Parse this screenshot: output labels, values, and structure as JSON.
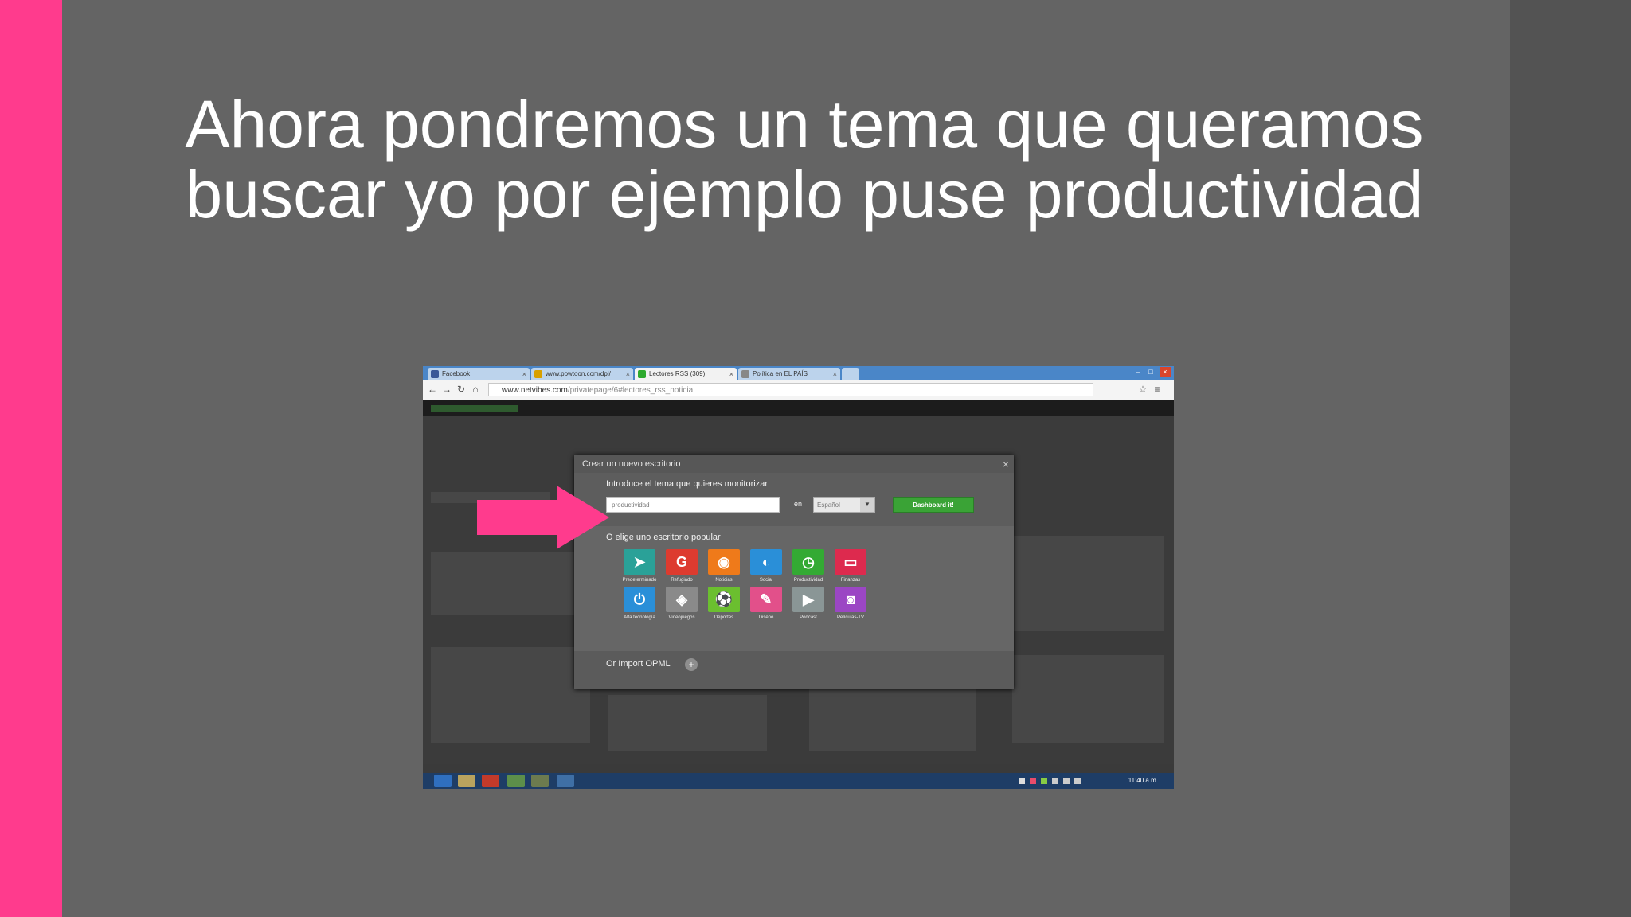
{
  "slide": {
    "title_line1": "Ahora pondremos un tema que queramos",
    "title_line2": "buscar yo por ejemplo puse productividad"
  },
  "colors": {
    "accent": "#ff3b8d",
    "slide_bg": "#646464",
    "button_green": "#3aa336",
    "taskbar": "#1e3d66"
  },
  "browser": {
    "tabs": [
      {
        "label": "Facebook",
        "icon": "facebook-icon",
        "color": "#3b5998"
      },
      {
        "label": "www.powtoon.com/dpl/",
        "icon": "trophy-icon",
        "color": "#d8a000"
      },
      {
        "label": "Lectores RSS (309)",
        "icon": "netvibes-icon",
        "color": "#2eaa2e"
      },
      {
        "label": "Política en EL PAÍS",
        "icon": "page-icon",
        "color": "#888888"
      }
    ],
    "url_domain": "www.netvibes.com",
    "url_path": "/privatepage/6#lectores_rss_noticia"
  },
  "dialog": {
    "title": "Crear un nuevo escritorio",
    "topic_label": "Introduce el tema que quieres monitorizar",
    "topic_value": "productividad",
    "in_label": "en",
    "language": "Español",
    "submit_label": "Dashboard it!",
    "popular_label": "O elige uno escritorio popular",
    "tiles": [
      {
        "label": "Predeterminado",
        "icon": "cursor-icon",
        "glyph": "➤",
        "color": "#2aa198"
      },
      {
        "label": "Refugiado",
        "icon": "google-icon",
        "glyph": "G",
        "color": "#dd3b2f"
      },
      {
        "label": "Noticias",
        "icon": "rss-icon",
        "glyph": "◉",
        "color": "#ef7a1a"
      },
      {
        "label": "Social",
        "icon": "bird-icon",
        "glyph": "◐",
        "color": "#2a8fd8"
      },
      {
        "label": "Productividad",
        "icon": "clock-icon",
        "glyph": "◷",
        "color": "#33aa33"
      },
      {
        "label": "Finanzas",
        "icon": "money-icon",
        "glyph": "▭",
        "color": "#dd2a4e"
      },
      {
        "label": "Alta tecnología",
        "icon": "power-icon",
        "glyph": "⏻",
        "color": "#2a8fd8"
      },
      {
        "label": "Videojuegos",
        "icon": "gamepad-icon",
        "glyph": "◈",
        "color": "#8a8a8a"
      },
      {
        "label": "Deportes",
        "icon": "ball-icon",
        "glyph": "⚽",
        "color": "#6bbf2f"
      },
      {
        "label": "Diseño",
        "icon": "pencil-icon",
        "glyph": "✎",
        "color": "#e2508a"
      },
      {
        "label": "Podcast",
        "icon": "play-icon",
        "glyph": "▶",
        "color": "#8a9696"
      },
      {
        "label": "Películas-TV",
        "icon": "film-icon",
        "glyph": "◙",
        "color": "#9b46c4"
      }
    ],
    "import_label": "Or Import OPML"
  },
  "taskbar": {
    "clock": "11:40 a.m."
  }
}
